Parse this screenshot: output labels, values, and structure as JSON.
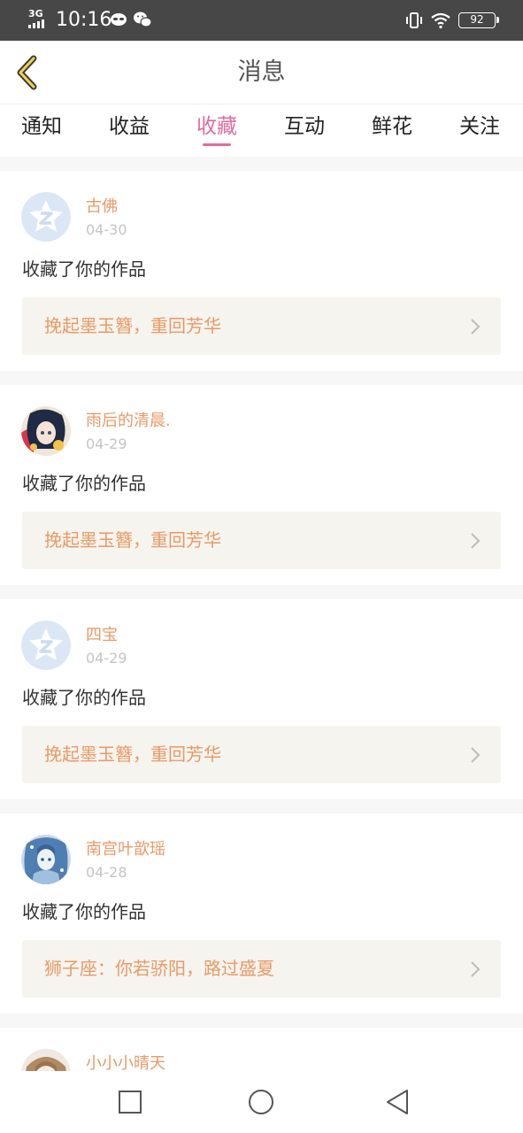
{
  "status_bar": {
    "network": "3G",
    "time": "10:16",
    "battery": "92",
    "icons": [
      "signal-icon",
      "game-app-icon",
      "wechat-icon",
      "vibrate-icon",
      "wifi-icon",
      "battery-icon"
    ]
  },
  "header": {
    "title": "消息",
    "back_icon": "chevron-left-icon"
  },
  "tabs": [
    {
      "label": "通知",
      "active": false
    },
    {
      "label": "收益",
      "active": false
    },
    {
      "label": "收藏",
      "active": true
    },
    {
      "label": "互动",
      "active": false
    },
    {
      "label": "鲜花",
      "active": false
    },
    {
      "label": "关注",
      "active": false
    }
  ],
  "messages": [
    {
      "user": "古佛",
      "date": "04-30",
      "action": "收藏了你的作品",
      "work": "挽起墨玉簪，重回芳华",
      "avatar": "default-star-avatar"
    },
    {
      "user": "雨后的清晨.",
      "date": "04-29",
      "action": "收藏了你的作品",
      "work": "挽起墨玉簪，重回芳华",
      "avatar": "anime-girl-avatar"
    },
    {
      "user": "四宝",
      "date": "04-29",
      "action": "收藏了你的作品",
      "work": "挽起墨玉簪，重回芳华",
      "avatar": "default-star-avatar"
    },
    {
      "user": "南宫叶歆瑶",
      "date": "04-28",
      "action": "收藏了你的作品",
      "work": "狮子座：你若骄阳，路过盛夏",
      "avatar": "anime-blue-avatar"
    },
    {
      "user": "小小小晴天",
      "date": "",
      "action": "",
      "work": "",
      "avatar": "anime-doll-avatar"
    }
  ],
  "colors": {
    "accent": "#e36a9e",
    "name": "#e89a67",
    "work_bg": "#f5f4ee",
    "status_bar": "#474747"
  },
  "nav": {
    "icons": [
      "recent-apps-icon",
      "home-icon",
      "back-icon"
    ]
  }
}
